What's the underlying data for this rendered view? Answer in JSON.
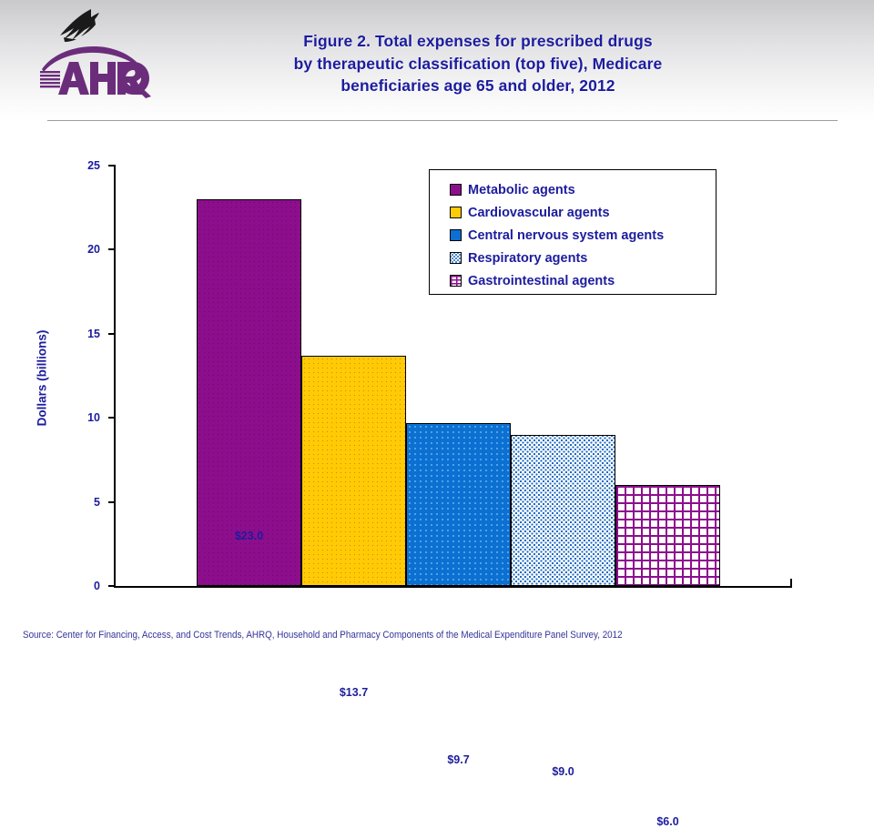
{
  "header": {
    "logo_alt": "AHRQ Agency for Healthcare Research and Quality",
    "title_lines": [
      "Figure 2. Total expenses for prescribed drugs",
      "by therapeutic classification (top five), Medicare",
      "beneficiaries age 65 and older, 2012"
    ]
  },
  "footer": {
    "source": "Source: Center for Financing, Access, and Cost Trends, AHRQ, Household and Pharmacy Components of the Medical Expenditure Panel Survey,  2012"
  },
  "legend": {
    "items": [
      {
        "label": "Metabolic agents",
        "swatch": "metabolic-swatch"
      },
      {
        "label": "Cardiovascular agents",
        "swatch": "cardiovascular-swatch"
      },
      {
        "label": "Central nervous system agents",
        "swatch": "cns-swatch"
      },
      {
        "label": "Respiratory agents",
        "swatch": "respiratory-swatch"
      },
      {
        "label": "Gastrointestinal agents",
        "swatch": "gastrointestinal-swatch"
      }
    ]
  },
  "axis": {
    "y_title": "Dollars (billions)",
    "y_ticks": [
      "25",
      "20",
      "15",
      "10",
      "5",
      "0"
    ]
  },
  "chart_data": {
    "type": "bar",
    "title": "Figure 2. Total expenses for prescribed drugs by therapeutic classification (top five), Medicare beneficiaries age 65 and older, 2012",
    "xlabel": "",
    "ylabel": "Dollars (billions)",
    "ylim": [
      0,
      25
    ],
    "yticks": [
      0,
      5,
      10,
      15,
      20,
      25
    ],
    "grid": false,
    "legend_position": "inside-top-right",
    "categories": [
      "Metabolic agents",
      "Cardiovascular agents",
      "Central nervous system agents",
      "Respiratory agents",
      "Gastrointestinal agents"
    ],
    "values": [
      23.0,
      13.7,
      9.7,
      9.0,
      6.0
    ],
    "data_labels": [
      "$23.0",
      "$13.7",
      "$9.7",
      "$9.0",
      "$6.0"
    ],
    "colors": [
      "#8d0e8d",
      "#ffcb05",
      "#0c70d2",
      "#1565c0",
      "#8d0e8d"
    ],
    "fills": [
      "solid-purple",
      "solid-yellow",
      "solid-blue",
      "blue-stipple-on-white",
      "purple-brick-on-white"
    ]
  },
  "colors": {
    "text_blue": "#1c1c9e",
    "metabolic": "#8d0e8d",
    "cardiovascular": "#ffcb05",
    "cns": "#0c70d2",
    "respiratory": "#1565c0",
    "gastrointestinal": "#8d0e8d"
  }
}
